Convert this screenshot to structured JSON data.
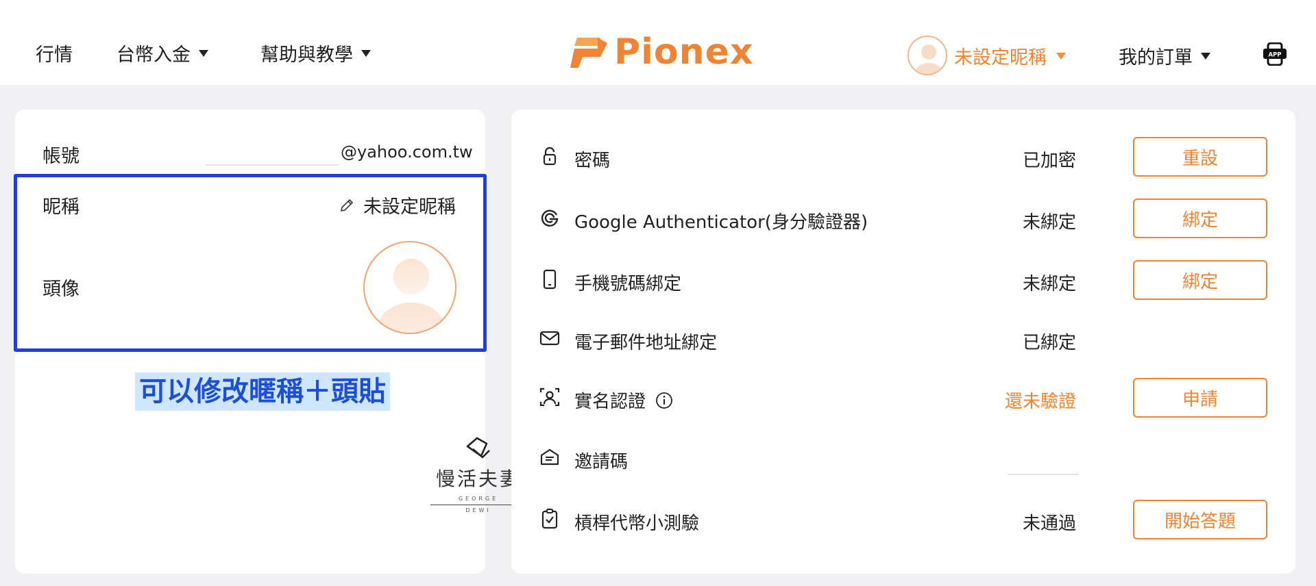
{
  "header": {
    "nav": [
      {
        "label": "行情"
      },
      {
        "label": "台幣入金"
      },
      {
        "label": "幫助與教學"
      }
    ],
    "logo_text": "Pionex",
    "nickname_menu": "未設定昵稱",
    "orders_menu": "我的訂單",
    "app_badge": "APP"
  },
  "account": {
    "account_label": "帳號",
    "email_suffix": "@yahoo.com.tw",
    "nickname_label": "昵稱",
    "nickname_value": "未設定昵稱",
    "avatar_label": "頭像"
  },
  "annotation": "可以修改暱稱＋頭貼",
  "watermark": {
    "title": "慢活夫妻",
    "sub1": "GEORGE",
    "sub2": "DEWI"
  },
  "security": [
    {
      "icon": "lock-icon",
      "label": "密碼",
      "status": "已加密",
      "button": "重設"
    },
    {
      "icon": "google-icon",
      "label": "Google Authenticator(身分驗證器)",
      "status": "未綁定",
      "button": "綁定"
    },
    {
      "icon": "phone-icon",
      "label": "手機號碼綁定",
      "status": "未綁定",
      "button": "綁定"
    },
    {
      "icon": "mail-icon",
      "label": "電子郵件地址綁定",
      "status": "已綁定",
      "button": ""
    },
    {
      "icon": "id-verify-icon",
      "label": "實名認證",
      "status": "還未驗證",
      "button": "申請"
    },
    {
      "icon": "invite-icon",
      "label": "邀請碼",
      "status": "",
      "button": ""
    },
    {
      "icon": "quiz-icon",
      "label": "槓桿代幣小測驗",
      "status": "未通過",
      "button": "開始答題"
    }
  ],
  "colors": {
    "accent": "#f08432",
    "highlight_border": "#1f3fdc",
    "annotation_bg": "#cfe6ff"
  }
}
